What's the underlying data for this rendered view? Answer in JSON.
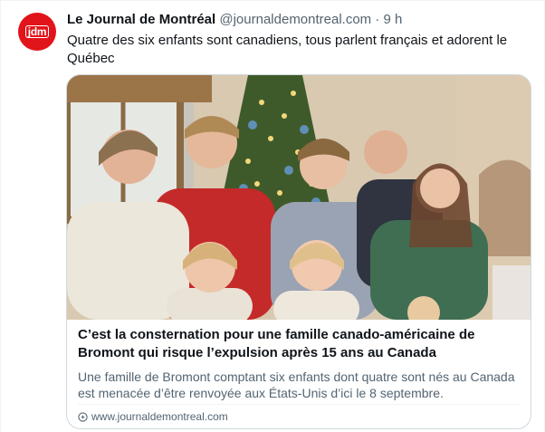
{
  "account": {
    "avatar_text": "jdm",
    "name": "Le Journal de Montréal",
    "handle": "@journaldemontreal.com",
    "separator": "·",
    "time": "9 h"
  },
  "tweet": {
    "text": "Quatre des six enfants sont canadiens, tous parlent français et adorent le Québec"
  },
  "card": {
    "image_icon": "family-photo-christmas-tree",
    "title": "C’est la consternation pour une famille canado-américaine de Bromont qui risque l’expulsion après 15 ans au Canada",
    "description": "Une famille de Bromont comptant six enfants dont quatre sont nés au Canada est menacée d’être renvoyée aux États-Unis d’ici le 8 septembre.",
    "url": "www.journaldemontreal.com",
    "url_icon": "link-icon"
  },
  "colors": {
    "brand_red": "#e1141a",
    "text_primary": "#0f1419",
    "text_secondary": "#536471",
    "border": "#cfd9de"
  }
}
